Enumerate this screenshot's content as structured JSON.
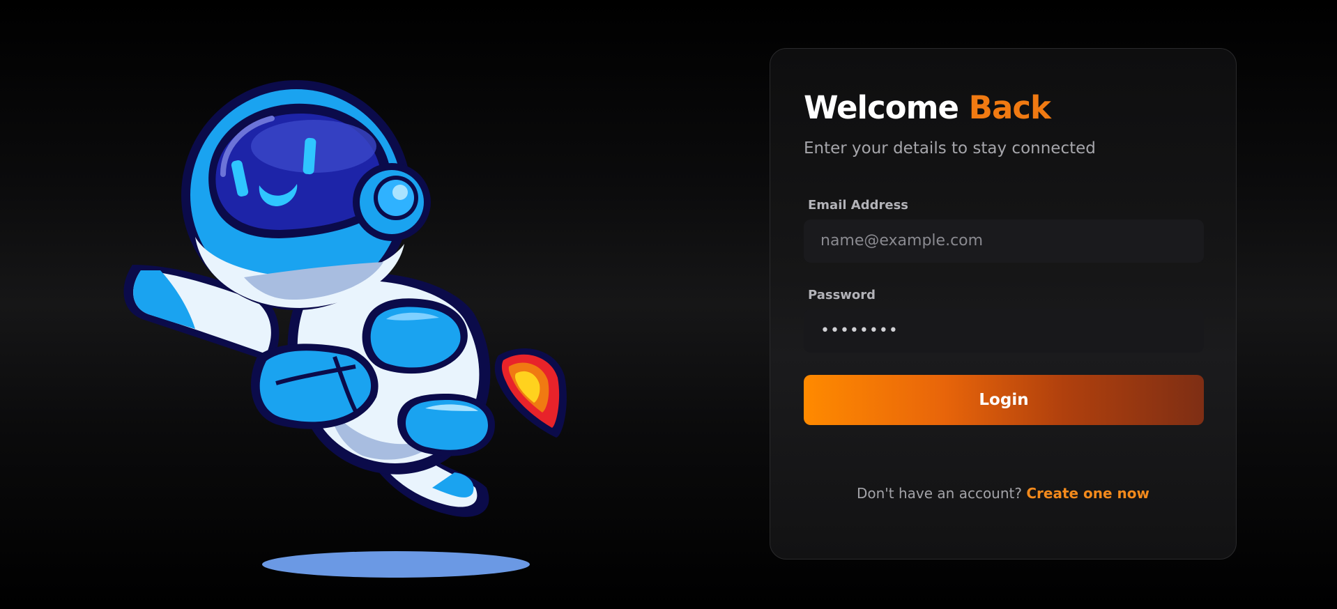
{
  "illustration": {
    "name": "astronaut-mascot"
  },
  "login_card": {
    "title_main": "Welcome",
    "title_accent": "Back",
    "subtitle": "Enter your details to stay connected",
    "email_label": "Email Address",
    "email_placeholder": "name@example.com",
    "password_label": "Password",
    "password_value": "••••••••",
    "login_button": "Login",
    "signup_prompt": "Don't have an account?",
    "signup_link": "Create one now"
  },
  "colors": {
    "accent": "#f07a12",
    "button_gradient_start": "#ff8a00",
    "button_gradient_end": "#7e2e14",
    "background": "#000000",
    "card_border": "#2a2a2c"
  }
}
